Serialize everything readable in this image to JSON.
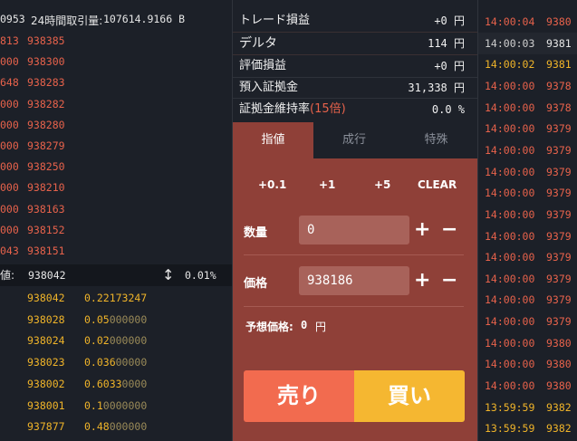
{
  "orderbook": {
    "header_left": "0953",
    "header_label": "24時間取引量:",
    "header_value": "107614.9166 B",
    "asks": [
      {
        "c1": "813",
        "c2": "938385"
      },
      {
        "c1": "000",
        "c2": "938300"
      },
      {
        "c1": "648",
        "c2": "938283"
      },
      {
        "c1": "000",
        "c2": "938282"
      },
      {
        "c1": "000",
        "c2": "938280"
      },
      {
        "c1": "000",
        "c2": "938279"
      },
      {
        "c1": "000",
        "c2": "938250"
      },
      {
        "c1": "000",
        "c2": "938210"
      },
      {
        "c1": "000",
        "c2": "938163"
      },
      {
        "c1": "000",
        "c2": "938152"
      },
      {
        "c1": "043",
        "c2": "938151"
      }
    ],
    "mid": {
      "prefix": "値:",
      "price": "938042",
      "arrow": "↕",
      "spread": "0.01%"
    },
    "bids": [
      {
        "price": "938042",
        "v1": "0.22173247",
        "v2": ""
      },
      {
        "price": "938028",
        "v1": "0.05",
        "v2": "000000"
      },
      {
        "price": "938024",
        "v1": "0.02",
        "v2": "000000"
      },
      {
        "price": "938023",
        "v1": "0.036",
        "v2": "00000"
      },
      {
        "price": "938002",
        "v1": "0.6033",
        "v2": "0000"
      },
      {
        "price": "938001",
        "v1": "0.1",
        "v2": "0000000"
      },
      {
        "price": "937877",
        "v1": "0.48",
        "v2": "000000"
      }
    ]
  },
  "stats": [
    {
      "label": "トレード損益",
      "value": "+0 円"
    },
    {
      "label": "デルタ",
      "value": "114 円"
    },
    {
      "label": "評価損益",
      "value": "+0 円"
    },
    {
      "label": "預入証拠金",
      "value": "31,338 円"
    },
    {
      "label": "証拠金維持率",
      "label_suffix": "(15倍)",
      "value": "0.0 %"
    }
  ],
  "tabs": [
    "指値",
    "成行",
    "特殊"
  ],
  "increments": [
    "+0.1",
    "+1",
    "+5",
    "CLEAR"
  ],
  "form": {
    "quantity_label": "数量",
    "quantity_value": "0",
    "price_label": "価格",
    "price_value": "938186",
    "expected_label": "予想価格:",
    "expected_value": "0",
    "expected_unit": "円",
    "plus": "+",
    "minus": "−"
  },
  "buttons": {
    "sell": "売り",
    "buy": "買い"
  },
  "colors": {
    "ask": "#e7624b",
    "bid": "#f0b429",
    "order_bg": "#8f4038",
    "sell": "#f26b4f",
    "buy": "#f5b731"
  },
  "trades": [
    {
      "time": "14:00:04",
      "price": "9380",
      "color": "#e7624b",
      "time_color": "#e7624b"
    },
    {
      "time": "14:00:03",
      "price": "9381",
      "color": "#e6e6e6",
      "time_color": "#cfcfcf"
    },
    {
      "time": "14:00:02",
      "price": "9381",
      "color": "#f0b429",
      "time_color": "#f0b429"
    },
    {
      "time": "14:00:00",
      "price": "9378",
      "color": "#e7624b",
      "time_color": "#e7624b"
    },
    {
      "time": "14:00:00",
      "price": "9378",
      "color": "#e7624b",
      "time_color": "#e7624b"
    },
    {
      "time": "14:00:00",
      "price": "9379",
      "color": "#e7624b",
      "time_color": "#e7624b"
    },
    {
      "time": "14:00:00",
      "price": "9379",
      "color": "#e7624b",
      "time_color": "#e7624b"
    },
    {
      "time": "14:00:00",
      "price": "9379",
      "color": "#e7624b",
      "time_color": "#e7624b"
    },
    {
      "time": "14:00:00",
      "price": "9379",
      "color": "#e7624b",
      "time_color": "#e7624b"
    },
    {
      "time": "14:00:00",
      "price": "9379",
      "color": "#e7624b",
      "time_color": "#e7624b"
    },
    {
      "time": "14:00:00",
      "price": "9379",
      "color": "#e7624b",
      "time_color": "#e7624b"
    },
    {
      "time": "14:00:00",
      "price": "9379",
      "color": "#e7624b",
      "time_color": "#e7624b"
    },
    {
      "time": "14:00:00",
      "price": "9379",
      "color": "#e7624b",
      "time_color": "#e7624b"
    },
    {
      "time": "14:00:00",
      "price": "9379",
      "color": "#e7624b",
      "time_color": "#e7624b"
    },
    {
      "time": "14:00:00",
      "price": "9379",
      "color": "#e7624b",
      "time_color": "#e7624b"
    },
    {
      "time": "14:00:00",
      "price": "9380",
      "color": "#e7624b",
      "time_color": "#e7624b"
    },
    {
      "time": "14:00:00",
      "price": "9380",
      "color": "#e7624b",
      "time_color": "#e7624b"
    },
    {
      "time": "14:00:00",
      "price": "9380",
      "color": "#e7624b",
      "time_color": "#e7624b"
    },
    {
      "time": "13:59:59",
      "price": "9382",
      "color": "#f0b429",
      "time_color": "#f0b429"
    },
    {
      "time": "13:59:59",
      "price": "9382",
      "color": "#f0b429",
      "time_color": "#f0b429"
    }
  ]
}
